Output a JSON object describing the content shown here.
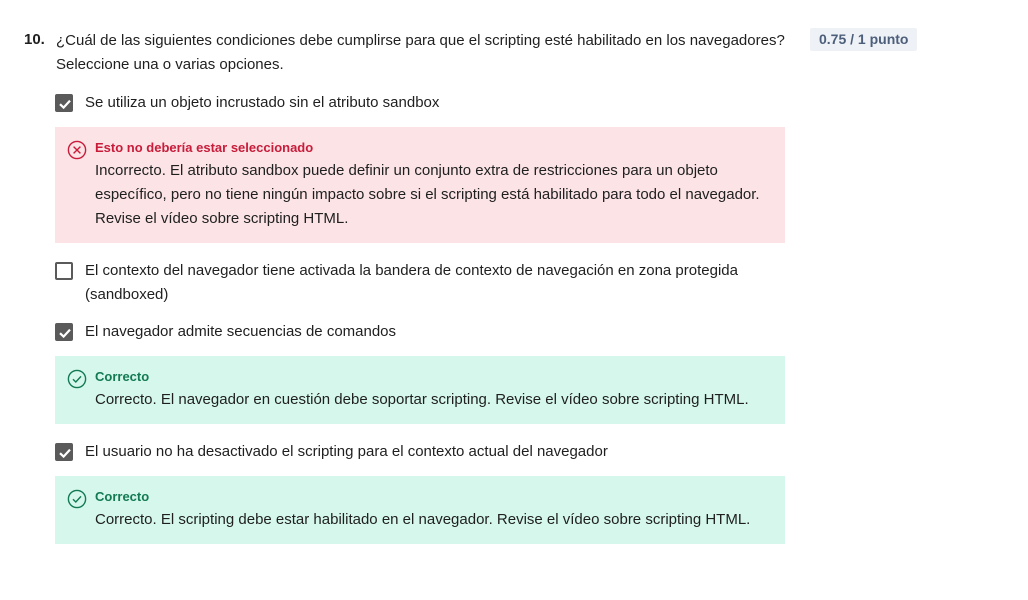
{
  "question": {
    "number": "10.",
    "text": "¿Cuál de las siguientes condiciones debe cumplirse para que el scripting esté habilitado en los navegadores? Seleccione una o varias opciones.",
    "score": "0.75 / 1 punto"
  },
  "options": [
    {
      "label": "Se utiliza un objeto incrustado sin el atributo sandbox",
      "checked": true,
      "feedback": {
        "status": "incorrect",
        "icon": "x-circle-icon",
        "title": "Esto no debería estar seleccionado",
        "body": "Incorrecto. El atributo sandbox puede definir un conjunto extra de restricciones para un objeto específico, pero no tiene ningún impacto sobre si el scripting está habilitado para todo el navegador. Revise el vídeo sobre scripting HTML."
      }
    },
    {
      "label": "El contexto del navegador tiene activada la bandera de contexto de navegación en zona protegida (sandboxed)",
      "checked": false
    },
    {
      "label": "El navegador admite secuencias de comandos",
      "checked": true,
      "feedback": {
        "status": "correct",
        "icon": "check-circle-icon",
        "title": "Correcto",
        "body": "Correcto. El navegador en cuestión debe soportar scripting. Revise el vídeo sobre scripting HTML."
      }
    },
    {
      "label": "El usuario no ha desactivado el scripting para el contexto actual del navegador",
      "checked": true,
      "feedback": {
        "status": "correct",
        "icon": "check-circle-icon",
        "title": "Correcto",
        "body": "Correcto. El scripting debe estar habilitado en el navegador. Revise el vídeo sobre scripting HTML."
      }
    }
  ],
  "colors": {
    "incorrect_bg": "#fbe3e6",
    "incorrect_accent": "#c81c3a",
    "correct_bg": "#d5f7ec",
    "correct_accent": "#137a53",
    "checkbox": "#5a5a5a",
    "score_bg": "#eef1f6"
  }
}
